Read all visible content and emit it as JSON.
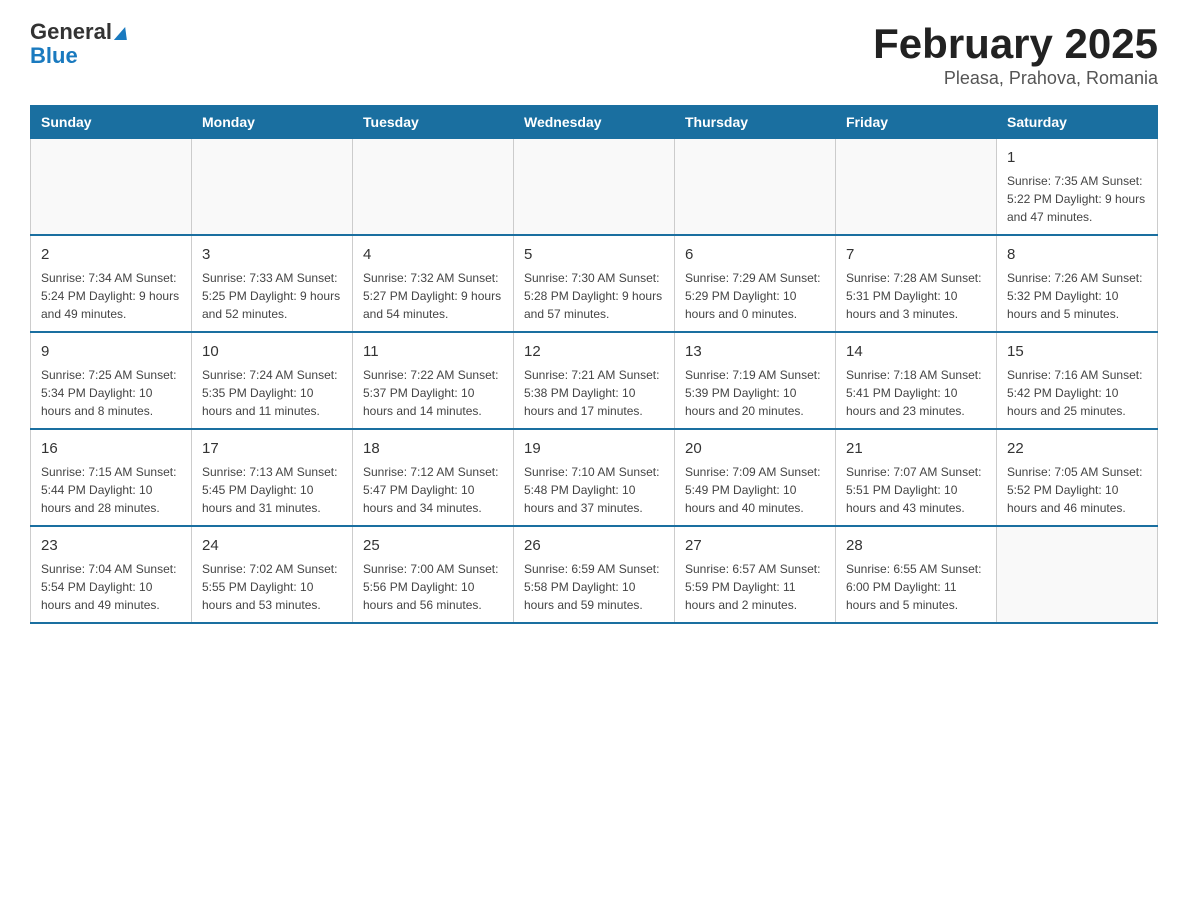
{
  "logo": {
    "line1": "General",
    "line2": "Blue"
  },
  "title": "February 2025",
  "location": "Pleasa, Prahova, Romania",
  "weekdays": [
    "Sunday",
    "Monday",
    "Tuesday",
    "Wednesday",
    "Thursday",
    "Friday",
    "Saturday"
  ],
  "weeks": [
    [
      {
        "day": "",
        "info": ""
      },
      {
        "day": "",
        "info": ""
      },
      {
        "day": "",
        "info": ""
      },
      {
        "day": "",
        "info": ""
      },
      {
        "day": "",
        "info": ""
      },
      {
        "day": "",
        "info": ""
      },
      {
        "day": "1",
        "info": "Sunrise: 7:35 AM\nSunset: 5:22 PM\nDaylight: 9 hours and 47 minutes."
      }
    ],
    [
      {
        "day": "2",
        "info": "Sunrise: 7:34 AM\nSunset: 5:24 PM\nDaylight: 9 hours and 49 minutes."
      },
      {
        "day": "3",
        "info": "Sunrise: 7:33 AM\nSunset: 5:25 PM\nDaylight: 9 hours and 52 minutes."
      },
      {
        "day": "4",
        "info": "Sunrise: 7:32 AM\nSunset: 5:27 PM\nDaylight: 9 hours and 54 minutes."
      },
      {
        "day": "5",
        "info": "Sunrise: 7:30 AM\nSunset: 5:28 PM\nDaylight: 9 hours and 57 minutes."
      },
      {
        "day": "6",
        "info": "Sunrise: 7:29 AM\nSunset: 5:29 PM\nDaylight: 10 hours and 0 minutes."
      },
      {
        "day": "7",
        "info": "Sunrise: 7:28 AM\nSunset: 5:31 PM\nDaylight: 10 hours and 3 minutes."
      },
      {
        "day": "8",
        "info": "Sunrise: 7:26 AM\nSunset: 5:32 PM\nDaylight: 10 hours and 5 minutes."
      }
    ],
    [
      {
        "day": "9",
        "info": "Sunrise: 7:25 AM\nSunset: 5:34 PM\nDaylight: 10 hours and 8 minutes."
      },
      {
        "day": "10",
        "info": "Sunrise: 7:24 AM\nSunset: 5:35 PM\nDaylight: 10 hours and 11 minutes."
      },
      {
        "day": "11",
        "info": "Sunrise: 7:22 AM\nSunset: 5:37 PM\nDaylight: 10 hours and 14 minutes."
      },
      {
        "day": "12",
        "info": "Sunrise: 7:21 AM\nSunset: 5:38 PM\nDaylight: 10 hours and 17 minutes."
      },
      {
        "day": "13",
        "info": "Sunrise: 7:19 AM\nSunset: 5:39 PM\nDaylight: 10 hours and 20 minutes."
      },
      {
        "day": "14",
        "info": "Sunrise: 7:18 AM\nSunset: 5:41 PM\nDaylight: 10 hours and 23 minutes."
      },
      {
        "day": "15",
        "info": "Sunrise: 7:16 AM\nSunset: 5:42 PM\nDaylight: 10 hours and 25 minutes."
      }
    ],
    [
      {
        "day": "16",
        "info": "Sunrise: 7:15 AM\nSunset: 5:44 PM\nDaylight: 10 hours and 28 minutes."
      },
      {
        "day": "17",
        "info": "Sunrise: 7:13 AM\nSunset: 5:45 PM\nDaylight: 10 hours and 31 minutes."
      },
      {
        "day": "18",
        "info": "Sunrise: 7:12 AM\nSunset: 5:47 PM\nDaylight: 10 hours and 34 minutes."
      },
      {
        "day": "19",
        "info": "Sunrise: 7:10 AM\nSunset: 5:48 PM\nDaylight: 10 hours and 37 minutes."
      },
      {
        "day": "20",
        "info": "Sunrise: 7:09 AM\nSunset: 5:49 PM\nDaylight: 10 hours and 40 minutes."
      },
      {
        "day": "21",
        "info": "Sunrise: 7:07 AM\nSunset: 5:51 PM\nDaylight: 10 hours and 43 minutes."
      },
      {
        "day": "22",
        "info": "Sunrise: 7:05 AM\nSunset: 5:52 PM\nDaylight: 10 hours and 46 minutes."
      }
    ],
    [
      {
        "day": "23",
        "info": "Sunrise: 7:04 AM\nSunset: 5:54 PM\nDaylight: 10 hours and 49 minutes."
      },
      {
        "day": "24",
        "info": "Sunrise: 7:02 AM\nSunset: 5:55 PM\nDaylight: 10 hours and 53 minutes."
      },
      {
        "day": "25",
        "info": "Sunrise: 7:00 AM\nSunset: 5:56 PM\nDaylight: 10 hours and 56 minutes."
      },
      {
        "day": "26",
        "info": "Sunrise: 6:59 AM\nSunset: 5:58 PM\nDaylight: 10 hours and 59 minutes."
      },
      {
        "day": "27",
        "info": "Sunrise: 6:57 AM\nSunset: 5:59 PM\nDaylight: 11 hours and 2 minutes."
      },
      {
        "day": "28",
        "info": "Sunrise: 6:55 AM\nSunset: 6:00 PM\nDaylight: 11 hours and 5 minutes."
      },
      {
        "day": "",
        "info": ""
      }
    ]
  ]
}
